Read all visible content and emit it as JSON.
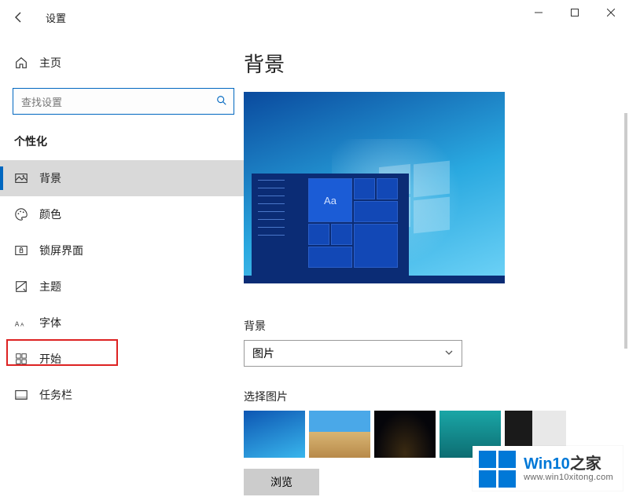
{
  "titlebar": {
    "title": "设置"
  },
  "sidebar": {
    "home_label": "主页",
    "search_placeholder": "查找设置",
    "section_header": "个性化",
    "items": [
      {
        "label": "背景"
      },
      {
        "label": "颜色"
      },
      {
        "label": "锁屏界面"
      },
      {
        "label": "主题"
      },
      {
        "label": "字体"
      },
      {
        "label": "开始"
      },
      {
        "label": "任务栏"
      }
    ],
    "active_index": 0,
    "highlighted_index": 6
  },
  "content": {
    "page_title": "背景",
    "preview_sample_text": "Aa",
    "background_label": "背景",
    "background_dropdown_value": "图片",
    "choose_picture_label": "选择图片",
    "browse_button": "浏览"
  },
  "watermark": {
    "brand_prefix": "Win10",
    "brand_suffix": "之家",
    "url": "www.win10xitong.com"
  }
}
